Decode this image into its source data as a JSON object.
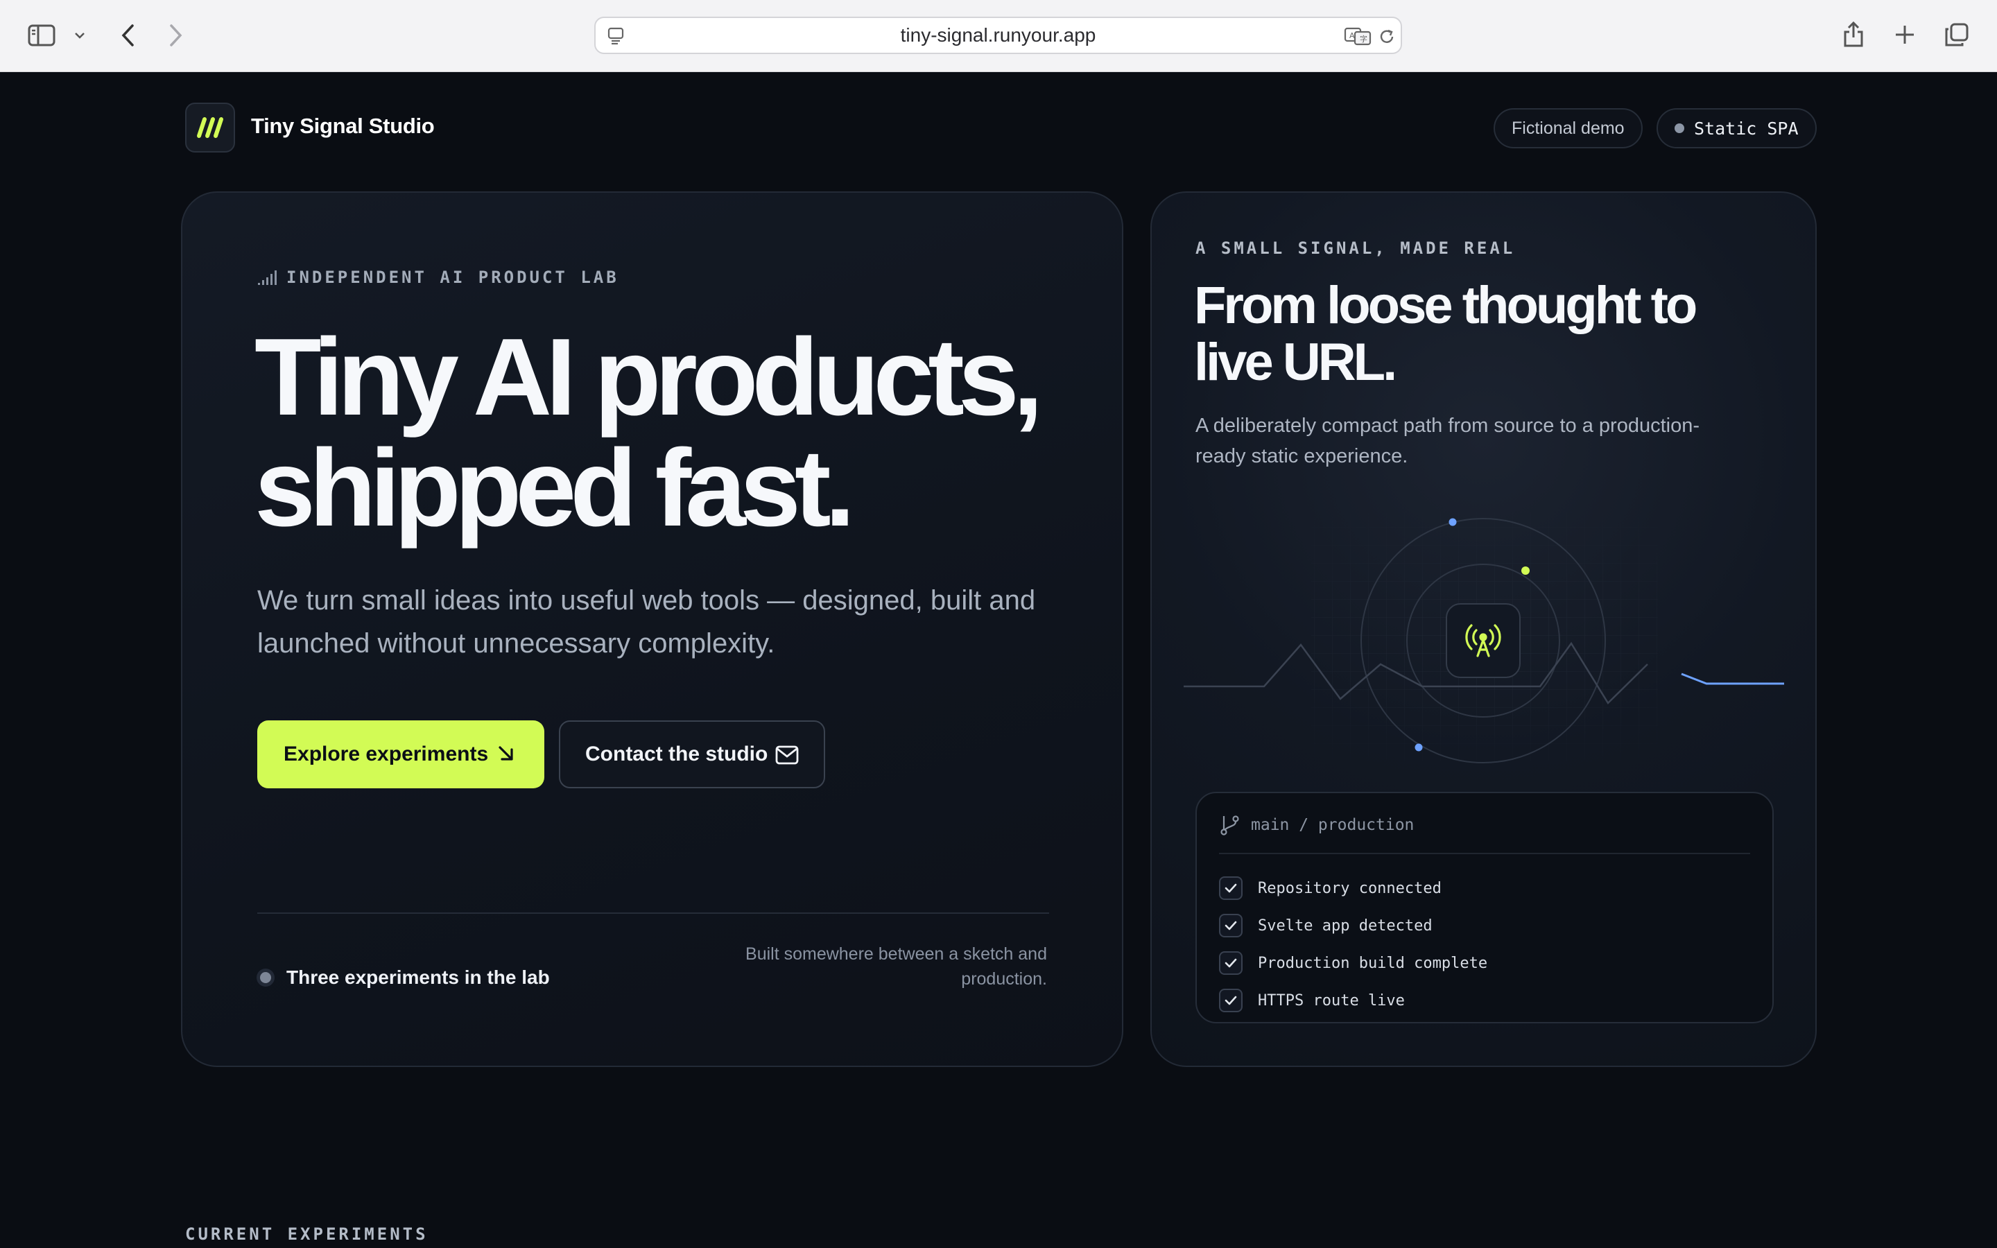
{
  "browser": {
    "url": "tiny-signal.runyour.app"
  },
  "header": {
    "brand": "Tiny Signal Studio",
    "pills": [
      "Fictional demo",
      "Static SPA"
    ]
  },
  "hero": {
    "eyebrow": "INDEPENDENT AI PRODUCT LAB",
    "headline_line1": "Tiny AI products,",
    "headline_line2": "shipped fast.",
    "subtitle": "We turn small ideas into useful web tools — designed, built and launched without unnecessary complexity.",
    "primary_button": "Explore experiments",
    "secondary_button": "Contact the studio",
    "status": "Three experiments in the lab",
    "note": "Built somewhere between a sketch and production."
  },
  "side": {
    "kicker": "A SMALL SIGNAL, MADE REAL",
    "title": "From loose thought to live URL.",
    "description": "A deliberately compact path from source to a production-ready static experience.",
    "branch": "main / production",
    "checklist": [
      "Repository connected",
      "Svelte app detected",
      "Production build complete",
      "HTTPS route live"
    ]
  },
  "sections": {
    "current_label": "CURRENT EXPERIMENTS"
  },
  "colors": {
    "accent": "#d2fb55",
    "background": "#0a0d13",
    "blue": "#6ea2ff"
  },
  "icons": [
    "sidebar-icon",
    "chevron-down-icon",
    "back-icon",
    "forward-icon",
    "reader-icon",
    "translate-icon",
    "reload-icon",
    "share-icon",
    "plus-icon",
    "tabs-icon",
    "logo-slashes-icon",
    "signal-bars-icon",
    "arrow-down-right-icon",
    "mail-icon",
    "antenna-icon",
    "git-branch-icon",
    "check-icon"
  ]
}
